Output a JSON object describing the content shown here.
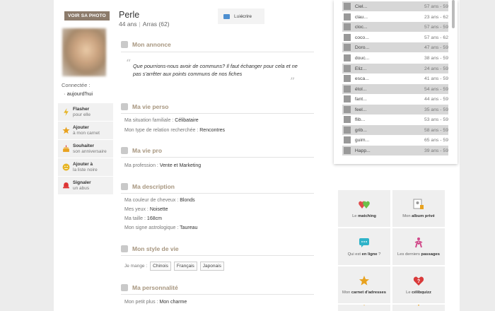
{
  "profile": {
    "photo_button": "VOIR SA PHOTO",
    "name": "Perle",
    "age": "44 ans",
    "city": "Arras (62)",
    "connected_label": "Connectée :",
    "connected_when": "aujourd'hui"
  },
  "write_button": {
    "prefix": "Lui ",
    "label": "écrire"
  },
  "actions": [
    {
      "bold": "Flasher",
      "rest": "pour elle",
      "icon": "lightning-icon",
      "color": "#e6b422"
    },
    {
      "bold": "Ajouter",
      "rest": "à mon carnet",
      "icon": "star-icon",
      "color": "#e8a21f"
    },
    {
      "bold": "Souhaiter",
      "rest": "son anniversaire",
      "icon": "cake-icon",
      "color": "#e8a21f"
    },
    {
      "bold": "Ajouter à",
      "rest": "la liste noire",
      "icon": "blacklist-icon",
      "color": "#e6b422"
    },
    {
      "bold": "Signaler",
      "rest": "un abus",
      "icon": "alert-icon",
      "color": "#d33"
    }
  ],
  "sections": {
    "annonce": {
      "title": "Mon annonce",
      "text": "Que pourrions-nous avoir de communs? Il faut échanger pour cela et ne pas s'arrêter aux points communs de nos fiches"
    },
    "vie_perso": {
      "title": "Ma vie perso",
      "situation_label": "Ma situation familiale :",
      "situation_value": "Célibataire",
      "relation_label": "Mon type de relation recherchée :",
      "relation_value": "Rencontres"
    },
    "vie_pro": {
      "title": "Ma vie pro",
      "profession_label": "Ma profession :",
      "profession_value": "Vente et Marketing"
    },
    "description": {
      "title": "Ma description",
      "hair_label": "Ma couleur de cheveux :",
      "hair_value": "Blonds",
      "eyes_label": "Mes yeux :",
      "eyes_value": "Noisette",
      "height_label": "Ma taille :",
      "height_value": "168cm",
      "sign_label": "Mon signe astrologique :",
      "sign_value": "Taureau"
    },
    "style": {
      "title": "Mon style de vie",
      "eat_label": "Je mange :",
      "tags": [
        "Chinois",
        "Français",
        "Japonais"
      ]
    },
    "personnalite": {
      "title": "Ma personnalité",
      "plus_label": "Mon petit plus :",
      "plus_value": "Mon charme"
    }
  },
  "members": [
    {
      "name": "Ciel...",
      "age": "57 ans - 59"
    },
    {
      "name": "clau...",
      "age": "23 ans - 62"
    },
    {
      "name": "cloc...",
      "age": "57 ans - 59"
    },
    {
      "name": "coco...",
      "age": "57 ans - 62"
    },
    {
      "name": "Doro...",
      "age": "47 ans - 59"
    },
    {
      "name": "douc...",
      "age": "38 ans - 59"
    },
    {
      "name": "Eliz...",
      "age": "24 ans - 59"
    },
    {
      "name": "esca...",
      "age": "41 ans - 59"
    },
    {
      "name": "étol...",
      "age": "54 ans - 59"
    },
    {
      "name": "fant...",
      "age": "44 ans - 59"
    },
    {
      "name": "feel...",
      "age": "35 ans - 59"
    },
    {
      "name": "flib...",
      "age": "53 ans - 59"
    },
    {
      "name": "grib...",
      "age": "58 ans - 59"
    },
    {
      "name": "guim...",
      "age": "65 ans - 59"
    },
    {
      "name": "Happ...",
      "age": "39 ans - 59"
    }
  ],
  "tiles": [
    {
      "pre": "Le ",
      "bold": "matching",
      "post": "",
      "icon": "matching-icon"
    },
    {
      "pre": "Mon ",
      "bold": "album privé",
      "post": "",
      "icon": "album-icon"
    },
    {
      "pre": "Qui est ",
      "bold": "en ligne",
      "post": " ?",
      "icon": "chat-icon"
    },
    {
      "pre": "Les derniers ",
      "bold": "passages",
      "post": "",
      "icon": "visits-icon"
    },
    {
      "pre": "Mon ",
      "bold": "carnet d'adresses",
      "post": "",
      "icon": "star-icon"
    },
    {
      "pre": "Le ",
      "bold": "célibquizz",
      "post": "",
      "icon": "quiz-icon"
    }
  ]
}
